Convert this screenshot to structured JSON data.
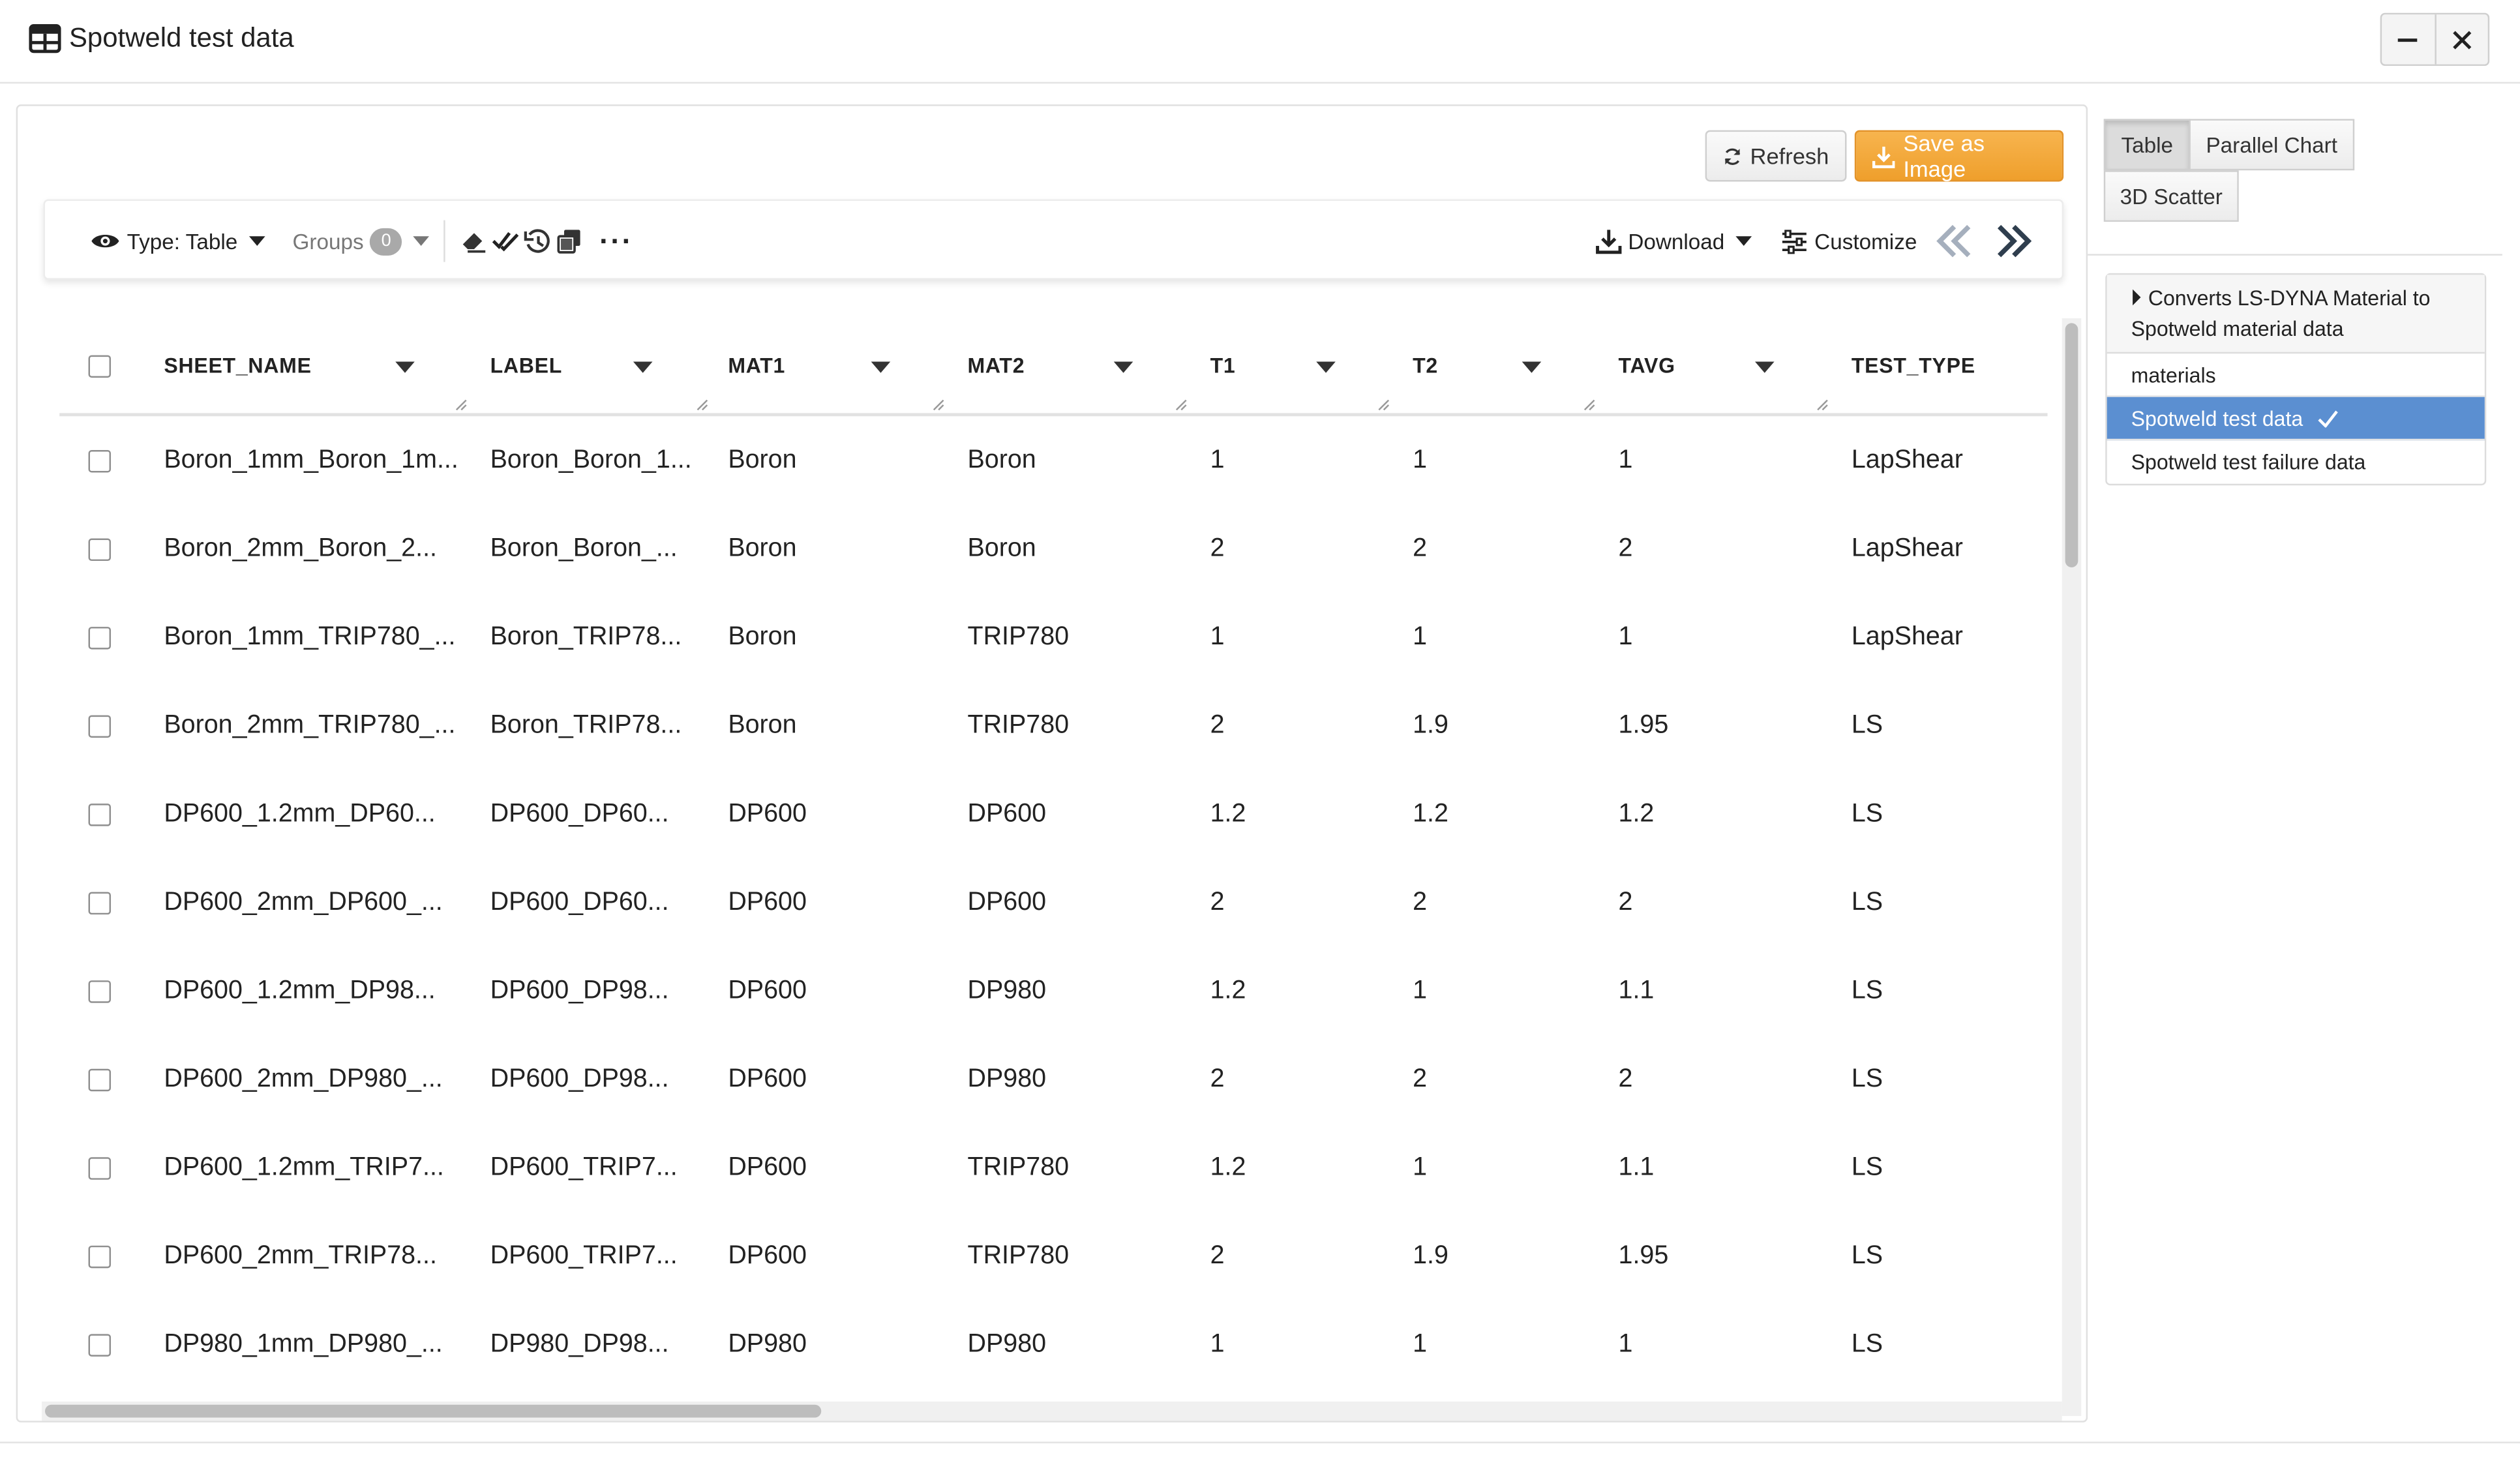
{
  "window": {
    "title": "Spotweld test data"
  },
  "actions": {
    "refresh_label": "Refresh",
    "save_image_label": "Save as Image"
  },
  "toolbar": {
    "type_label": "Type: Table",
    "groups_label": "Groups",
    "groups_count": "0",
    "more_label": "···",
    "download_label": "Download",
    "customize_label": "Customize"
  },
  "table": {
    "columns": [
      "SHEET_NAME",
      "LABEL",
      "MAT1",
      "MAT2",
      "T1",
      "T2",
      "TAVG",
      "TEST_TYPE"
    ],
    "rows": [
      [
        "Boron_1mm_Boron_1m...",
        "Boron_Boron_1...",
        "Boron",
        "Boron",
        "1",
        "1",
        "1",
        "LapShear"
      ],
      [
        "Boron_2mm_Boron_2...",
        "Boron_Boron_...",
        "Boron",
        "Boron",
        "2",
        "2",
        "2",
        "LapShear"
      ],
      [
        "Boron_1mm_TRIP780_...",
        "Boron_TRIP78...",
        "Boron",
        "TRIP780",
        "1",
        "1",
        "1",
        "LapShear"
      ],
      [
        "Boron_2mm_TRIP780_...",
        "Boron_TRIP78...",
        "Boron",
        "TRIP780",
        "2",
        "1.9",
        "1.95",
        "LS"
      ],
      [
        "DP600_1.2mm_DP60...",
        "DP600_DP60...",
        "DP600",
        "DP600",
        "1.2",
        "1.2",
        "1.2",
        "LS"
      ],
      [
        "DP600_2mm_DP600_...",
        "DP600_DP60...",
        "DP600",
        "DP600",
        "2",
        "2",
        "2",
        "LS"
      ],
      [
        "DP600_1.2mm_DP98...",
        "DP600_DP98...",
        "DP600",
        "DP980",
        "1.2",
        "1",
        "1.1",
        "LS"
      ],
      [
        "DP600_2mm_DP980_...",
        "DP600_DP98...",
        "DP600",
        "DP980",
        "2",
        "2",
        "2",
        "LS"
      ],
      [
        "DP600_1.2mm_TRIP7...",
        "DP600_TRIP7...",
        "DP600",
        "TRIP780",
        "1.2",
        "1",
        "1.1",
        "LS"
      ],
      [
        "DP600_2mm_TRIP78...",
        "DP600_TRIP7...",
        "DP600",
        "TRIP780",
        "2",
        "1.9",
        "1.95",
        "LS"
      ],
      [
        "DP980_1mm_DP980_...",
        "DP980_DP98...",
        "DP980",
        "DP980",
        "1",
        "1",
        "1",
        "LS"
      ]
    ]
  },
  "view_tabs": [
    "Table",
    "Parallel Chart",
    "3D Scatter"
  ],
  "dataset_list": {
    "header": "Converts LS-DYNA Material to Spotweld material data",
    "items": [
      "materials",
      "Spotweld test data",
      "Spotweld test failure data"
    ],
    "selected": "Spotweld test data"
  },
  "colors": {
    "accent": "#f0a030",
    "selection": "#5b8fd1"
  },
  "icons": [
    "table-icon",
    "minimize-icon",
    "close-icon",
    "refresh-icon",
    "download-icon",
    "eye-icon",
    "eraser-icon",
    "double-check-icon",
    "history-icon",
    "copy-icon",
    "sliders-icon",
    "chevrons-left-icon",
    "chevrons-right-icon",
    "caret-right-icon",
    "check-icon"
  ]
}
